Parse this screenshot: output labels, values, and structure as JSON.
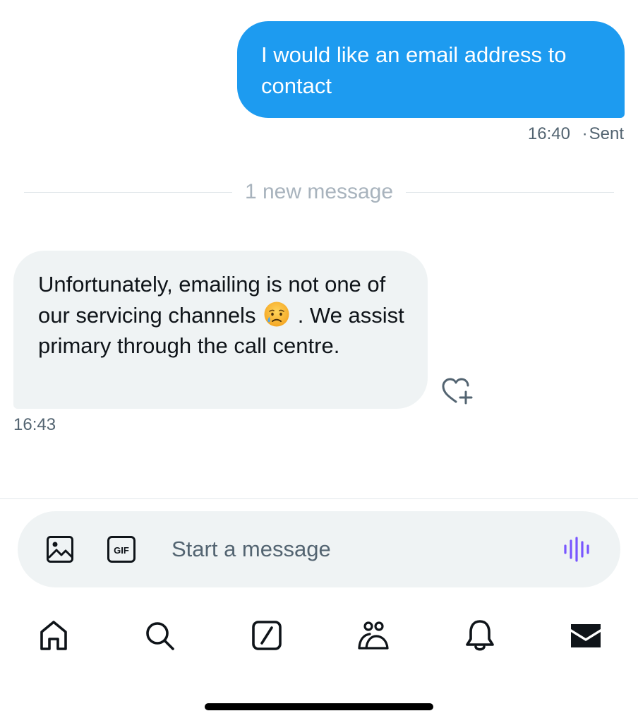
{
  "conversation": {
    "sent_message": {
      "text": "I would like an email address to contact",
      "time": "16:40",
      "status": "Sent",
      "separator": "·"
    },
    "new_message_divider": "1 new message",
    "received_message": {
      "text_before_emoji": "Unfortunately, emailing is not one of our servicing channels",
      "emoji": "sad-but-relieved-face",
      "text_after_emoji": ". We assist primary through the call centre.",
      "time": "16:43"
    }
  },
  "composer": {
    "placeholder": "Start a message",
    "media_icon": "image-icon",
    "gif_label": "GIF",
    "voice_icon": "voice-message-icon"
  },
  "tab_bar": {
    "items": [
      {
        "icon": "home-icon"
      },
      {
        "icon": "search-icon"
      },
      {
        "icon": "grok-icon"
      },
      {
        "icon": "communities-icon"
      },
      {
        "icon": "notifications-icon"
      },
      {
        "icon": "messages-icon",
        "active": true
      }
    ]
  },
  "colors": {
    "accent": "#1d9bf0",
    "received_bubble": "#eff3f4",
    "secondary_text": "#536471",
    "divider_text": "#a8b3bd",
    "voice_accent": "#7856ff"
  }
}
